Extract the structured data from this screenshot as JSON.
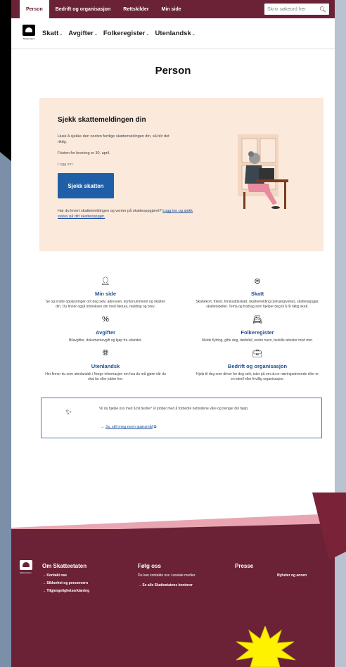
{
  "topbar": {
    "tabs": [
      "Person",
      "Bedrift og organisasjon",
      "Rettskilder",
      "Min side"
    ],
    "search_placeholder": "Skriv søkeord her"
  },
  "nav": {
    "logo_text": "Skatteetaten",
    "items": [
      "Skatt",
      "Avgifter",
      "Folkeregister",
      "Utenlandsk"
    ]
  },
  "page_title": "Person",
  "banner": {
    "heading": "Sjekk skattemeldingen din",
    "p1": "Husk å sjekke den nesten ferdige skattemeldingen din, så blir det riktig.",
    "p2": "Fristen for levering er 30. april.",
    "p3": "Logg inn:",
    "button": "Sjekk skatten",
    "p4_text": "Har du levert skattemeldingen og venter på skatteoppgjøret?",
    "p4_link": "Logg inn og sjekk status på ditt skatteoppgjør."
  },
  "cards": [
    {
      "title": "Min side",
      "desc": "Se og endre opplysninger om deg selv, adressen, kontonummeret og skatten din. Du finner også innboksen din med faktura, melding og brev."
    },
    {
      "title": "Skatt",
      "desc": "Skattekort, frikort, forskuddsskatt, skattemelding (selvangivelse), skatteoppgjør, skattetabeller. Tema og fradrag som hjelper deg til å få riktig skatt."
    },
    {
      "title": "Avgifter",
      "desc": "Bilavgifter, dokumentavgift og kjøp fra utlandet."
    },
    {
      "title": "Folkeregister",
      "desc": "Melde flytting, gifte deg, dødsfall, endre navn, bestille attester med mer."
    },
    {
      "title": "Utenlandsk",
      "desc": "Her finner du som utenlandsk i Norge informasjon om hva du må gjøre når du skal bo eller jobbe her."
    },
    {
      "title": "Bedrift og organisasjon",
      "desc": "Hjelp til deg som driver for deg selv, tuter på om du er næringsdrivende eller er en ideell eller frivillig organisasjon."
    }
  ],
  "feedback": {
    "text": "Vil du hjelpe oss med å bli bedre? Vi jobber med å forbedre nettsidene våre og trenger din hjelp.",
    "link": "Ja, still meg noen spørsmål"
  },
  "footer": {
    "logo_text": "Skatteetaten",
    "col1": {
      "heading": "Om Skatteetaten",
      "links": [
        "Kontakt oss",
        "Sikkerhet og personvern",
        "Tilgjengelighetserklæring"
      ]
    },
    "col2": {
      "heading": "Følg oss",
      "note": "Du kan kontakte oss i sosiale medier.",
      "links": [
        "Se alle Skatteetatens kontorer"
      ]
    },
    "col3": {
      "heading": "Presse",
      "links": [
        "Nyheter og annen"
      ]
    }
  },
  "colors": {
    "brand": "#6b2237",
    "link": "#1f4e93",
    "banner_bg": "#fbe9dc",
    "button": "#1f5fa8"
  }
}
